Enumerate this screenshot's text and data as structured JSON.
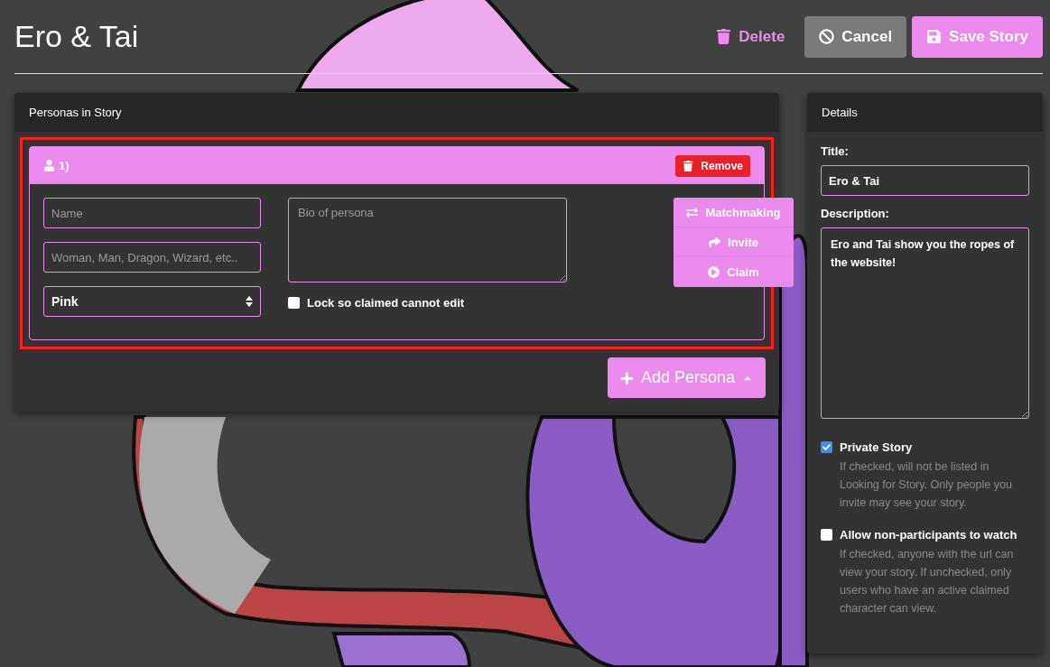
{
  "title": "Ero & Tai",
  "actions": [
    {
      "label": "Delete",
      "kind": "link"
    },
    {
      "label": "Cancel",
      "kind": "secondary"
    },
    {
      "label": "Save Story",
      "kind": "primary"
    }
  ],
  "personas_panel": {
    "heading": "Personas in Story",
    "highlighted": true,
    "personas": [
      {
        "number": "1)",
        "remove_label": "Remove",
        "name": {
          "placeholder": "Name"
        },
        "species": {
          "placeholder": "Woman, Man, Dragon, Wizard, etc.."
        },
        "color_choice": "Pink",
        "bio": {
          "placeholder": "Bio of persona"
        },
        "lock": {
          "label": "Lock so claimed cannot edit",
          "checked": false
        },
        "buttons": [
          {
            "label": "Matchmaking",
            "kind": "matchmaking"
          },
          {
            "label": "Invite",
            "kind": "invite"
          },
          {
            "label": "Claim",
            "kind": "claim"
          }
        ]
      }
    ],
    "add_button": {
      "label": "Add Persona",
      "plus": "+"
    }
  },
  "details": {
    "heading": "Details",
    "title_label": "Title:",
    "title_value": "Ero & Tai",
    "description_label": "Description:",
    "description_value": "Ero and Tai show you the ropes of the website!",
    "options": [
      {
        "label": "Private Story",
        "checked": true,
        "help": "If checked, will not be listed in Looking for Story. Only people you invite may see your story."
      },
      {
        "label": "Allow non-participants to watch",
        "checked": false,
        "help": "If checked, anyone with the url can view your story. If unchecked, only users who have an active claimed character can view."
      }
    ]
  }
}
